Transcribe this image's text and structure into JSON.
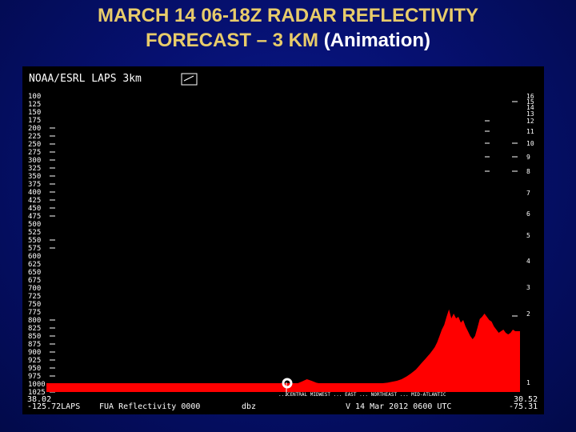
{
  "slide": {
    "title_line1": "MARCH 14 06-18Z RADAR REFLECTIVITY",
    "title_line2": "FORECAST – 3 KM",
    "title_suffix": "(Animation)",
    "title_color": "#e8cc6a"
  },
  "panel": {
    "header": "NOAA/ESRL  LAPS   3km",
    "footer_left_top": "38.02",
    "footer_left": "-125.72LAPS",
    "footer_product": "FUA Reflectivity 0000",
    "footer_units": "dbz",
    "footer_valid": "V  14  Mar 2012 0600 UTC",
    "footer_right_top": "30.52",
    "footer_right": "-75.31",
    "bottom_axis_text": "...CENTRAL MIDWEST ... EAST ... NORTHEAST ... MID-ATLANTIC"
  },
  "chart_data": {
    "type": "area",
    "title": "",
    "xlabel": "",
    "ylabel": "",
    "fill_color": "#ff0000",
    "left_axis_ticks": [
      "100",
      "125",
      "150",
      "175",
      "200",
      "225",
      "250",
      "275",
      "300",
      "325",
      "350",
      "375",
      "400",
      "425",
      "450",
      "475",
      "500",
      "525",
      "550",
      "575",
      "600",
      "625",
      "650",
      "675",
      "700",
      "725",
      "750",
      "775",
      "800",
      "825",
      "850",
      "875",
      "900",
      "925",
      "950",
      "975",
      "1000",
      "1025"
    ],
    "right_axis_ticks": [
      "16",
      "15",
      "14",
      "13",
      "12",
      "11",
      "10",
      "9",
      "8",
      "7",
      "6",
      "5",
      "4",
      "3",
      "2",
      "1"
    ],
    "ylim": [
      1025,
      100
    ],
    "xlim": [
      0,
      100
    ],
    "x": [
      0,
      5,
      10,
      15,
      20,
      25,
      30,
      35,
      40,
      45,
      48,
      50,
      52,
      53,
      54,
      55,
      56,
      57,
      58,
      60,
      62,
      65,
      68,
      70,
      72,
      74,
      75,
      76,
      77,
      78,
      78.5,
      79,
      79.5,
      80,
      80.5,
      81,
      81.5,
      82,
      82.5,
      83,
      83.5,
      84,
      84.5,
      85,
      85.5,
      86,
      86.5,
      87,
      87.5,
      88,
      88.5,
      89,
      89.5,
      90,
      90.5,
      91,
      91.5,
      92,
      92.5,
      93,
      93.5,
      94,
      94.5,
      95,
      95.5,
      96,
      96.5,
      97,
      97.5,
      98,
      98.5,
      99,
      99.5,
      100
    ],
    "y": [
      1000,
      1000,
      1000,
      1000,
      1000,
      1000,
      1000,
      1000,
      1000,
      1000,
      1000,
      1000,
      1000,
      998,
      992,
      985,
      990,
      996,
      999,
      1000,
      1000,
      1000,
      1000,
      999,
      996,
      990,
      985,
      977,
      967,
      955,
      947,
      938,
      930,
      922,
      913,
      905,
      895,
      885,
      870,
      850,
      830,
      815,
      790,
      767,
      795,
      780,
      795,
      790,
      808,
      800,
      820,
      835,
      850,
      860,
      850,
      825,
      797,
      790,
      780,
      790,
      800,
      805,
      820,
      830,
      840,
      835,
      830,
      840,
      845,
      840,
      830,
      835,
      835,
      835
    ]
  }
}
